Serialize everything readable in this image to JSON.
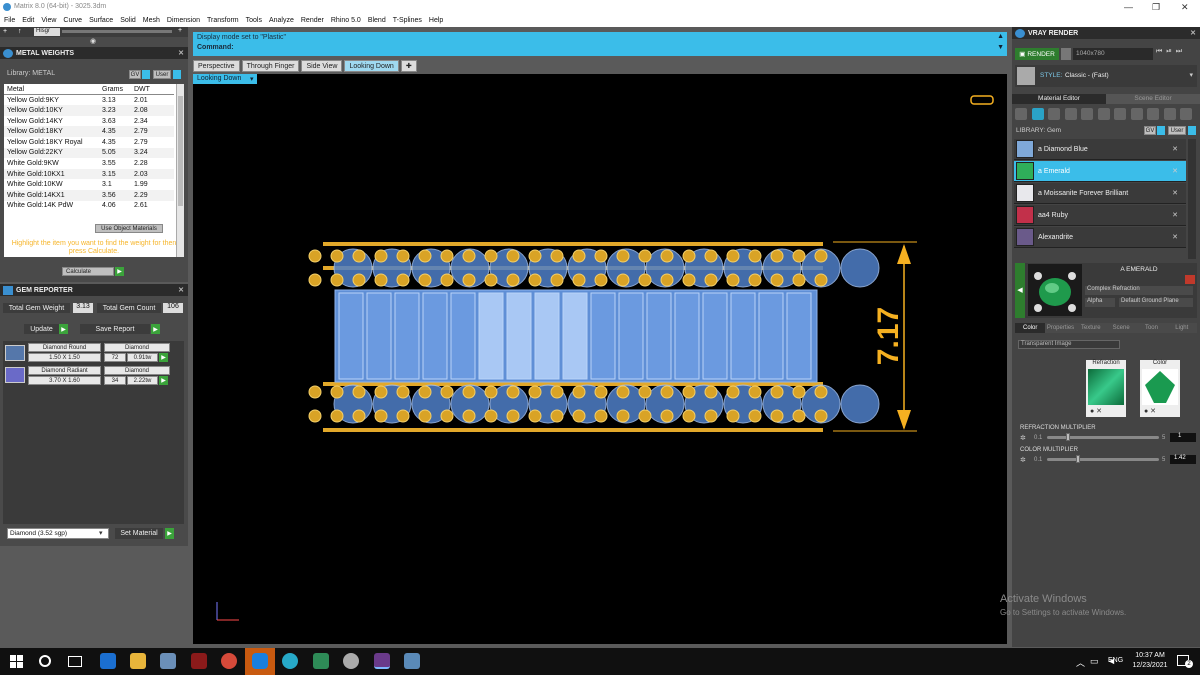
{
  "window": {
    "title": "Matrix 8.0 (64-bit) - 3025.3dm"
  },
  "menu": [
    "File",
    "Edit",
    "View",
    "Curve",
    "Surface",
    "Solid",
    "Mesh",
    "Dimension",
    "Transform",
    "Tools",
    "Analyze",
    "Render",
    "Rhino 5.0",
    "Blend",
    "T-Splines",
    "Help"
  ],
  "left_toolbar": {
    "field": "Hlsgr"
  },
  "metal_weights": {
    "title": "METAL WEIGHTS",
    "library_label": "Library: METAL",
    "gv": "GV",
    "user": "User",
    "columns": [
      "Metal",
      "Grams",
      "DWT"
    ],
    "rows": [
      [
        "Yellow Gold:9KY",
        "3.13",
        "2.01"
      ],
      [
        "Yellow Gold:10KY",
        "3.23",
        "2.08"
      ],
      [
        "Yellow Gold:14KY",
        "3.63",
        "2.34"
      ],
      [
        "Yellow Gold:18KY",
        "4.35",
        "2.79"
      ],
      [
        "Yellow Gold:18KY Royal",
        "4.35",
        "2.79"
      ],
      [
        "Yellow Gold:22KY",
        "5.05",
        "3.24"
      ],
      [
        "White Gold:9KW",
        "3.55",
        "2.28"
      ],
      [
        "White Gold:10KX1",
        "3.15",
        "2.03"
      ],
      [
        "White Gold:10KW",
        "3.1",
        "1.99"
      ],
      [
        "White Gold:14KX1",
        "3.56",
        "2.29"
      ],
      [
        "White Gold:14K PdW",
        "4.06",
        "2.61"
      ]
    ],
    "use_object_materials": "Use Object Materials",
    "hint": "Highlight the item you want to find the weight for then press Calculate.",
    "calculate": "Calculate"
  },
  "gem_reporter": {
    "title": "GEM REPORTER",
    "total_weight_label": "Total Gem Weight",
    "total_weight": "3.13",
    "total_count_label": "Total Gem Count",
    "total_count": "106",
    "update": "Update",
    "save_report": "Save Report",
    "gems": [
      {
        "shape": "Diamond Round",
        "material": "Diamond",
        "size": "1.50 X 1.50",
        "count": "72",
        "weight": "0.91tw"
      },
      {
        "shape": "Diamond Radiant",
        "material": "Diamond",
        "size": "3.70 X 1.60",
        "count": "34",
        "weight": "2.22tw"
      }
    ],
    "material_select": "Diamond    (3.52 sgp)",
    "set_material": "Set Material"
  },
  "command": {
    "line1": "Display mode set to \"Plastic\"",
    "prompt": "Command:"
  },
  "view_tabs": [
    {
      "label": "Perspective",
      "active": false
    },
    {
      "label": "Through Finger",
      "active": false
    },
    {
      "label": "Side View",
      "active": false
    },
    {
      "label": "Looking Down",
      "active": true
    }
  ],
  "viewport": {
    "label": "Looking Down",
    "dimension": "7.17"
  },
  "vray": {
    "title": "VRAY RENDER",
    "render": "RENDER",
    "resolution": "1040x780",
    "style_label": "STYLE:",
    "style_value": "Classic - (Fast)",
    "tabs": [
      "Material Editor",
      "Scene Editor"
    ],
    "library_label": "LIBRARY: Gem",
    "gv": "GV",
    "user": "User",
    "library": [
      {
        "name": "a Diamond Blue",
        "color": "#7fa8d8",
        "selected": false
      },
      {
        "name": "a Emerald",
        "color": "#2fae5a",
        "selected": true
      },
      {
        "name": "a Moissanite Forever Brilliant",
        "color": "#e8e8ec",
        "selected": false
      },
      {
        "name": "aa4 Ruby",
        "color": "#c2304a",
        "selected": false
      },
      {
        "name": "Alexandrite",
        "color": "#6a5a8a",
        "selected": false
      }
    ],
    "material_name": "A EMERALD",
    "material_type": "Complex Refraction",
    "alpha": "Alpha",
    "ground": "Default Ground Plane",
    "prop_tabs": [
      "Color",
      "Properties",
      "Texture",
      "Scene",
      "Toon",
      "Light"
    ],
    "transparent": "Transparent Image",
    "refraction": "Refraction",
    "color": "Color",
    "refraction_mult": {
      "label": "REFRACTION MULTIPLIER",
      "min": "0.1",
      "max": "5",
      "value": "1",
      "level": 0.18
    },
    "color_mult": {
      "label": "COLOR MULTIPLIER",
      "min": "0.1",
      "max": "5",
      "value": "1.42",
      "level": 0.27
    }
  },
  "watermark": {
    "line1": "Activate Windows",
    "line2": "Go to Settings to activate Windows."
  },
  "taskbar": {
    "lang": "ENG",
    "time": "10:37 AM",
    "date": "12/23/2021",
    "notif": "2"
  }
}
